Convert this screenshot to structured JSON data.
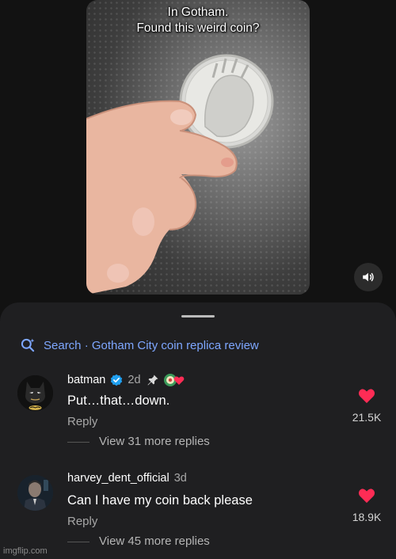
{
  "video": {
    "caption_line1": "In Gotham.",
    "caption_line2": "Found this weird coin?",
    "sound_icon": "volume-icon"
  },
  "search": {
    "icon": "search-sparkle-icon",
    "text": "Search · Gotham City coin replica review"
  },
  "comments": [
    {
      "username": "batman",
      "verified": true,
      "age": "2d",
      "pinned": true,
      "creator_liked": true,
      "text": "Put…that…down.",
      "reply_label": "Reply",
      "likes": "21.5K",
      "view_more": "View 31 more replies"
    },
    {
      "username": "harvey_dent_official",
      "verified": false,
      "age": "3d",
      "text": "Can I have my coin back please",
      "reply_label": "Reply",
      "likes": "18.9K",
      "view_more": "View 45 more replies"
    }
  ],
  "colors": {
    "link": "#7ea7ff",
    "heart": "#fe2c55",
    "sheet_bg": "#1f1f21",
    "verified": "#20a0f0"
  },
  "watermark": "imgflip.com"
}
